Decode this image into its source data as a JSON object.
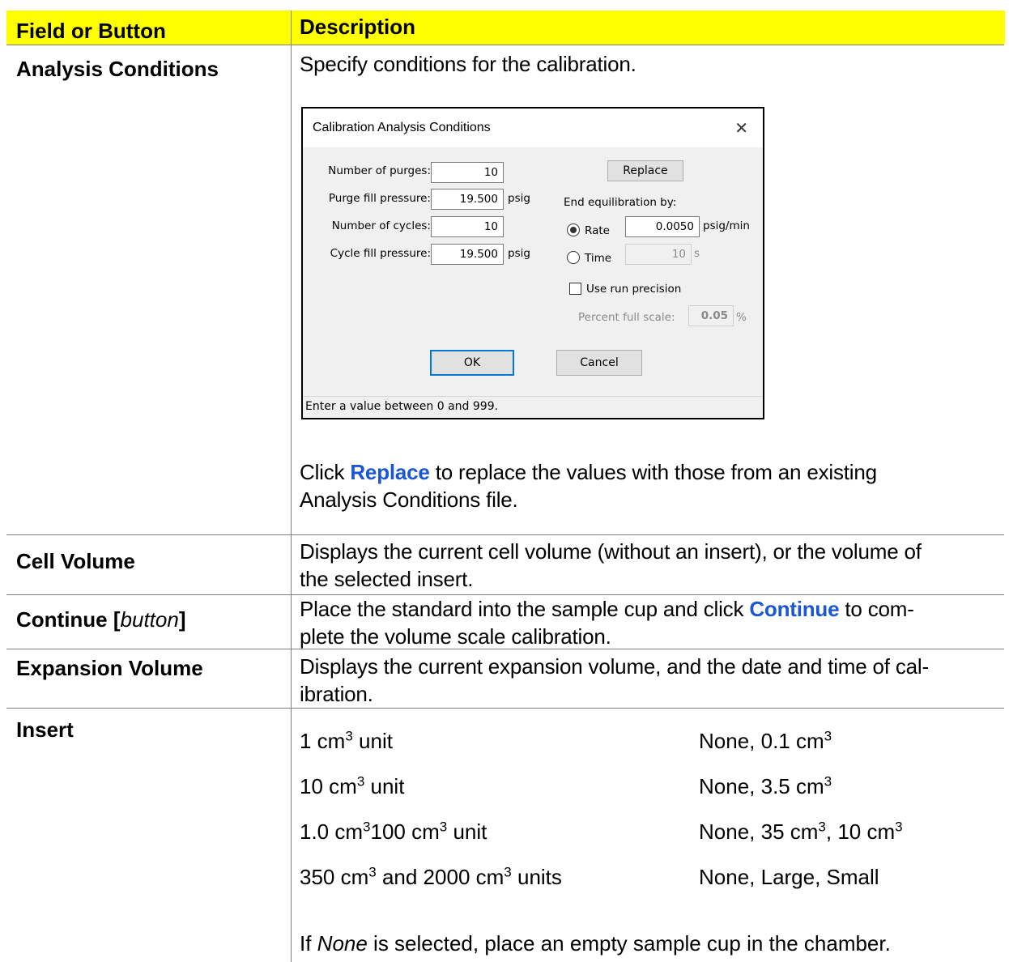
{
  "table": {
    "header_field": "Field or Button",
    "header_description": "Description"
  },
  "rows": {
    "analysis_conditions": {
      "field": "Analysis Conditions",
      "desc": "Specify conditions for the calibration.",
      "click_prefix": "Click ",
      "click_button": "Replace",
      "click_suffix_line1": " to replace the values with those from an existing",
      "click_line2": "Analysis Conditions file."
    },
    "cell_volume": {
      "field": "Cell Volume",
      "desc_line1": "Displays the current cell volume (without an insert), or the volume of",
      "desc_line2": "the selected insert."
    },
    "continue": {
      "field_prefix": "Continue [",
      "field_italic": "button",
      "field_suffix": "]",
      "desc_line1_prefix": "Place the standard into the sample cup and click ",
      "desc_line1_button": "Continue",
      "desc_line1_suffix": " to com-",
      "desc_line2": "plete the volume scale calibration."
    },
    "expansion_volume": {
      "field": "Expansion Volume",
      "desc_line1": "Displays the current expansion volume, and the date and time of cal-",
      "desc_line2": "ibration."
    },
    "insert": {
      "field": "Insert",
      "units": [
        {
          "unit_pre": "1 cm",
          "unit_sup": "3",
          "unit_post": " unit",
          "opt_pre": "None, 0.1 cm",
          "opt_sup": "3",
          "opt_mid": "",
          "opt_sup2": "",
          "opt_post": ""
        },
        {
          "unit_pre": "10 cm",
          "unit_sup": "3",
          "unit_post": " unit",
          "opt_pre": "None, 3.5 cm",
          "opt_sup": "3",
          "opt_mid": "",
          "opt_sup2": "",
          "opt_post": ""
        },
        {
          "unit_pre": "1.0 cm",
          "unit_sup": "3",
          "unit_post": "100 cm",
          "unit_sup2": "3",
          "unit_post2": " unit",
          "opt_pre": "None, 35 cm",
          "opt_sup": "3",
          "opt_mid": ", 10 cm",
          "opt_sup2": "3",
          "opt_post": ""
        },
        {
          "unit_pre": "350 cm",
          "unit_sup": "3",
          "unit_post": " and 2000 cm",
          "unit_sup2": "3",
          "unit_post2": " units",
          "opt_pre": "None, Large, Small",
          "opt_sup": "",
          "opt_mid": "",
          "opt_sup2": "",
          "opt_post": ""
        }
      ],
      "note_prefix": "If ",
      "note_italic": "None",
      "note_suffix": " is selected, place an empty sample cup in the chamber."
    }
  },
  "dialog": {
    "title": "Calibration Analysis Conditions",
    "close_glyph": "✕",
    "number_of_purges_label": "Number of purges:",
    "number_of_purges_value": "10",
    "purge_fill_pressure_label": "Purge fill pressure:",
    "purge_fill_pressure_value": "19.500",
    "number_of_cycles_label": "Number of cycles:",
    "number_of_cycles_value": "10",
    "cycle_fill_pressure_label": "Cycle fill pressure:",
    "cycle_fill_pressure_value": "19.500",
    "psig_unit": "psig",
    "replace_button": "Replace",
    "end_equilibration_label": "End equilibration by:",
    "rate_label": "Rate",
    "rate_value": "0.0050",
    "rate_unit": "psig/min",
    "time_label": "Time",
    "time_value": "10",
    "time_unit": "s",
    "use_run_precision_label": "Use run precision",
    "percent_full_scale_label": "Percent full scale:",
    "percent_full_scale_value": "0.05",
    "percent_unit": "%",
    "ok_button": "OK",
    "cancel_button": "Cancel",
    "status_text": "Enter a value between 0 and 999.",
    "rate_selected": true,
    "use_run_precision_checked": false
  }
}
